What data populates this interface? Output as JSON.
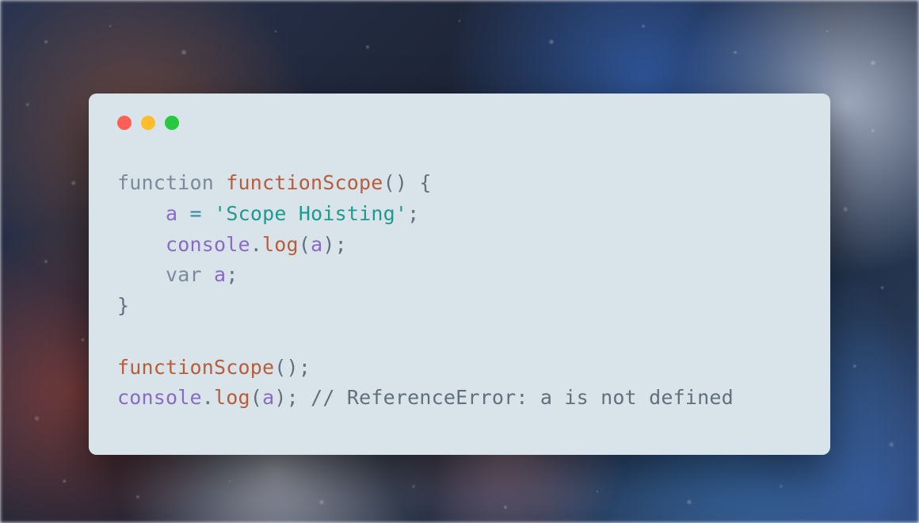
{
  "window": {
    "traffic_lights": {
      "red": "#ff5f56",
      "yellow": "#ffbd2e",
      "green": "#27c93f"
    }
  },
  "code": {
    "line1": {
      "kw_function": "function",
      "sp1": " ",
      "fn_name": "functionScope",
      "paren_open": "(",
      "paren_close": ")",
      "sp2": " ",
      "brace_open": "{"
    },
    "line2": {
      "indent": "    ",
      "var_a": "a",
      "sp1": " ",
      "op_eq": "=",
      "sp2": " ",
      "str": "'Scope Hoisting'",
      "semi": ";"
    },
    "line3": {
      "indent": "    ",
      "obj": "console",
      "dot": ".",
      "method": "log",
      "paren_open": "(",
      "arg": "a",
      "paren_close": ")",
      "semi": ";"
    },
    "line4": {
      "indent": "    ",
      "kw_var": "var",
      "sp1": " ",
      "var_a": "a",
      "semi": ";"
    },
    "line5": {
      "brace_close": "}"
    },
    "line6": {
      "blank": ""
    },
    "line7": {
      "fn_call": "functionScope",
      "paren_open": "(",
      "paren_close": ")",
      "semi": ";"
    },
    "line8": {
      "obj": "console",
      "dot": ".",
      "method": "log",
      "paren_open": "(",
      "arg": "a",
      "paren_close": ")",
      "semi": ";",
      "sp1": " ",
      "comment": "// ReferenceError: a is not defined"
    }
  }
}
